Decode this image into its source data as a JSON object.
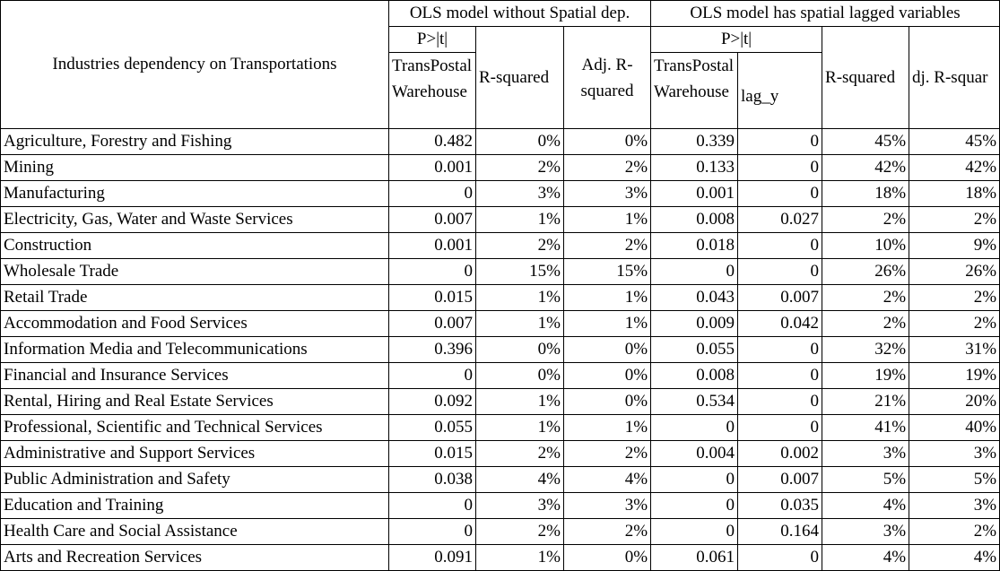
{
  "header": {
    "industry_col": "Industries dependency on Transportations",
    "group1": "OLS model without Spatial dep.",
    "group2": "OLS model has spatial lagged variables",
    "p_label_1": "P>|t|",
    "p_label_2": "P>|t|",
    "col_trans_1": "TransPostalWarehouse",
    "col_rsq_1": "R-squared",
    "col_adj_1": "Adj. R-squared",
    "col_trans_2": "TransPostalWarehouse",
    "col_lag": "lag_y",
    "col_rsq_2": "R-squared",
    "col_adj_2": "dj. R-squar"
  },
  "rows": [
    {
      "industry": "Agriculture,  Forestry and Fishing",
      "p1": "0.482",
      "r1": "0%",
      "a1": "0%",
      "p2": "0.339",
      "lag": "0",
      "r2": "45%",
      "a2": "45%"
    },
    {
      "industry": "Mining",
      "p1": "0.001",
      "r1": "2%",
      "a1": "2%",
      "p2": "0.133",
      "lag": "0",
      "r2": "42%",
      "a2": "42%"
    },
    {
      "industry": "Manufacturing",
      "p1": "0",
      "r1": "3%",
      "a1": "3%",
      "p2": "0.001",
      "lag": "0",
      "r2": "18%",
      "a2": "18%"
    },
    {
      "industry": "Electricity,  Gas,  Water and Waste Services",
      "p1": "0.007",
      "r1": "1%",
      "a1": "1%",
      "p2": "0.008",
      "lag": "0.027",
      "r2": "2%",
      "a2": "2%"
    },
    {
      "industry": "Construction",
      "p1": "0.001",
      "r1": "2%",
      "a1": "2%",
      "p2": "0.018",
      "lag": "0",
      "r2": "10%",
      "a2": "9%"
    },
    {
      "industry": "Wholesale Trade",
      "p1": "0",
      "r1": "15%",
      "a1": "15%",
      "p2": "0",
      "lag": "0",
      "r2": "26%",
      "a2": "26%"
    },
    {
      "industry": "Retail Trade",
      "p1": "0.015",
      "r1": "1%",
      "a1": "1%",
      "p2": "0.043",
      "lag": "0.007",
      "r2": "2%",
      "a2": "2%"
    },
    {
      "industry": "Accommodation and Food Services",
      "p1": "0.007",
      "r1": "1%",
      "a1": "1%",
      "p2": "0.009",
      "lag": "0.042",
      "r2": "2%",
      "a2": "2%"
    },
    {
      "industry": "Information Media and Telecommunications",
      "p1": "0.396",
      "r1": "0%",
      "a1": "0%",
      "p2": "0.055",
      "lag": "0",
      "r2": "32%",
      "a2": "31%"
    },
    {
      "industry": "Financial and Insurance Services",
      "p1": "0",
      "r1": "0%",
      "a1": "0%",
      "p2": "0.008",
      "lag": "0",
      "r2": "19%",
      "a2": "19%"
    },
    {
      "industry": "Rental,  Hiring and Real Estate Services",
      "p1": "0.092",
      "r1": "1%",
      "a1": "0%",
      "p2": "0.534",
      "lag": "0",
      "r2": "21%",
      "a2": "20%"
    },
    {
      "industry": "Professional,  Scientific and Technical Services",
      "p1": "0.055",
      "r1": "1%",
      "a1": "1%",
      "p2": "0",
      "lag": "0",
      "r2": "41%",
      "a2": "40%"
    },
    {
      "industry": "Administrative and Support Services",
      "p1": "0.015",
      "r1": "2%",
      "a1": "2%",
      "p2": "0.004",
      "lag": "0.002",
      "r2": "3%",
      "a2": "3%"
    },
    {
      "industry": "Public Administration and Safety",
      "p1": "0.038",
      "r1": "4%",
      "a1": "4%",
      "p2": "0",
      "lag": "0.007",
      "r2": "5%",
      "a2": "5%"
    },
    {
      "industry": "Education and Training",
      "p1": "0",
      "r1": "3%",
      "a1": "3%",
      "p2": "0",
      "lag": "0.035",
      "r2": "4%",
      "a2": "3%"
    },
    {
      "industry": "Health Care and Social Assistance",
      "p1": "0",
      "r1": "2%",
      "a1": "2%",
      "p2": "0",
      "lag": "0.164",
      "r2": "3%",
      "a2": "2%"
    },
    {
      "industry": "Arts and Recreation Services",
      "p1": "0.091",
      "r1": "1%",
      "a1": "0%",
      "p2": "0.061",
      "lag": "0",
      "r2": "4%",
      "a2": "4%"
    }
  ]
}
